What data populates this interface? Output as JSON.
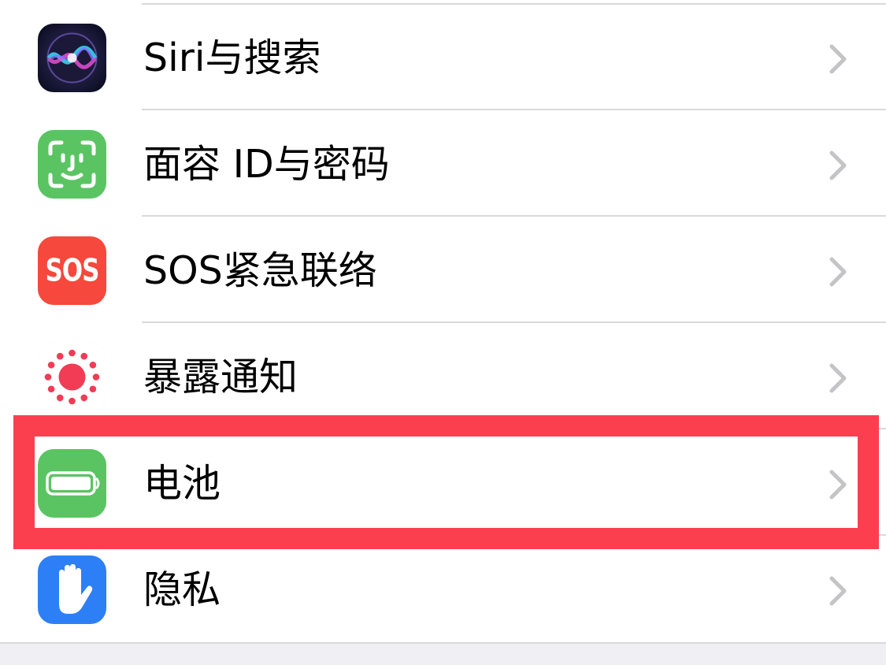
{
  "settings": {
    "items": [
      {
        "label": "Siri与搜索",
        "icon": "siri-icon"
      },
      {
        "label": "面容 ID与密码",
        "icon": "face-id-icon"
      },
      {
        "label": "SOS紧急联络",
        "icon": "sos-icon",
        "icon_text": "SOS"
      },
      {
        "label": "暴露通知",
        "icon": "exposure-notification-icon"
      },
      {
        "label": "电池",
        "icon": "battery-icon",
        "highlighted": true
      },
      {
        "label": "隐私",
        "icon": "privacy-hand-icon"
      }
    ]
  },
  "colors": {
    "highlight": "#fb3f4f",
    "face_id_bg": "#5ac463",
    "sos_bg": "#f6483c",
    "exposure_red": "#f23b55",
    "battery_bg": "#5ac463",
    "privacy_bg": "#2d7ff6",
    "separator": "#d9d9dc",
    "chevron": "#c4c4c7"
  }
}
